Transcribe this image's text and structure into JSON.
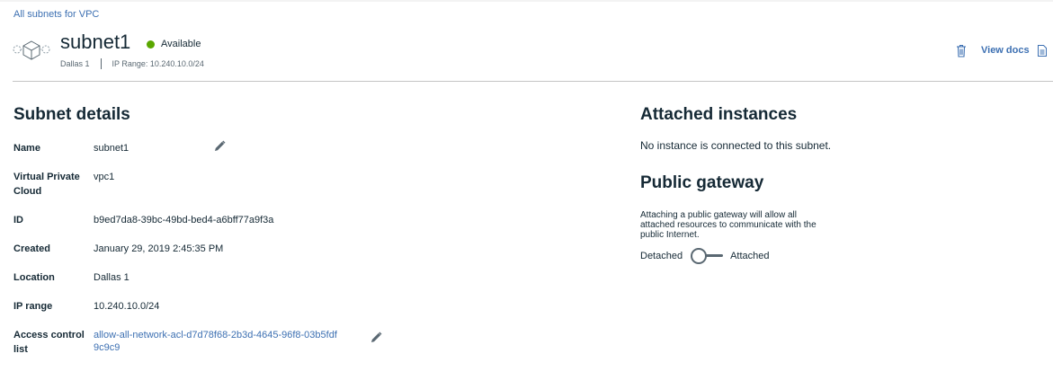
{
  "breadcrumb": "All subnets for VPC",
  "header": {
    "title": "subnet1",
    "status": "Available",
    "status_color": "#5aa700",
    "location": "Dallas 1",
    "ip_range": "IP Range: 10.240.10.0/24",
    "view_docs": "View docs",
    "icons": [
      "subnet-icon",
      "trash-icon",
      "document-icon"
    ]
  },
  "details": {
    "title": "Subnet details",
    "rows": [
      {
        "label": "Name",
        "value": "subnet1",
        "editable": true
      },
      {
        "label": "Virtual Private Cloud",
        "label_line1": "Virtual Private",
        "label_line2": "Cloud",
        "value": "vpc1"
      },
      {
        "label": "ID",
        "value": "b9ed7da8-39bc-49bd-bed4-a6bff77a9f3a"
      },
      {
        "label": "Created",
        "value": "January 29, 2019 2:45:35 PM"
      },
      {
        "label": "Location",
        "value": "Dallas 1"
      },
      {
        "label": "IP range",
        "value": "10.240.10.0/24"
      },
      {
        "label": "Access control list",
        "label_line1": "Access control",
        "label_line2": "list",
        "value": "allow-all-network-acl-d7d78f68-2b3d-4645-96f8-03b5fdf9c9c9",
        "value_line1": "allow-all-network-acl-d7d78f68-2b3d-4645-96f8-03b5fdf",
        "value_line2": "9c9c9",
        "editable": true
      }
    ]
  },
  "attached": {
    "title": "Attached instances",
    "empty_text": "No instance is connected to this subnet."
  },
  "gateway": {
    "title": "Public gateway",
    "description_lines": [
      "Attaching a public gateway will allow all",
      "attached resources to communicate with the",
      "public Internet."
    ],
    "toggle_off_label": "Detached",
    "toggle_on_label": "Attached",
    "state": "Detached"
  }
}
